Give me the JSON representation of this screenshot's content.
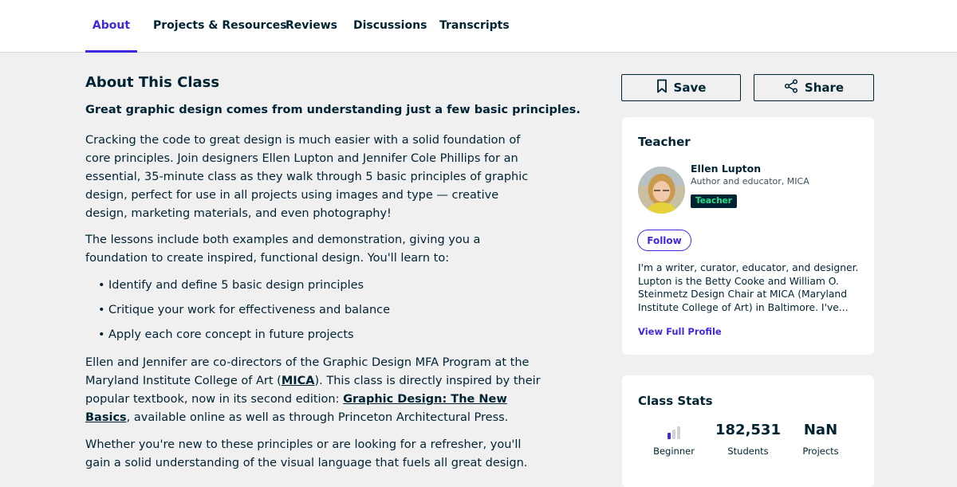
{
  "tabs": [
    {
      "label": "About",
      "active": true
    },
    {
      "label": "Projects & Resources"
    },
    {
      "label": "Reviews"
    },
    {
      "label": "Discussions"
    },
    {
      "label": "Transcripts"
    }
  ],
  "about": {
    "heading": "About This Class",
    "lead": "Great graphic design comes from understanding just a few basic principles.",
    "p1": "Cracking the code to great design is much easier with a solid foundation of core principles. Join designers Ellen Lupton and Jennifer Cole Phillips for an essential, 35-minute class as they walk through 5 basic principles of graphic design, perfect for use in all projects using images and type — creative design, marketing materials, and even photography!",
    "p2": "The lessons include both examples and demonstration, giving you a foundation to create inspired, functional design. You'll learn to:",
    "bullets": [
      "Identify and define 5 basic design principles",
      "Critique your work for effectiveness and balance",
      "Apply each core concept in future projects"
    ],
    "p3_a": "Ellen and Jennifer are co-directors of the Graphic Design MFA Program at the Maryland Institute College of Art (",
    "p3_link1": "MICA",
    "p3_b": "). This class is directly inspired by their popular textbook, now in its second edition: ",
    "p3_link2": "Graphic Design: The New Basics",
    "p3_c": ", available online as well as through Princeton Architectural Press.",
    "p4": "Whether you're new to these principles or are looking for a refresher, you'll gain a solid understanding of the visual language that fuels all great design."
  },
  "actions": {
    "save_label": "Save",
    "share_label": "Share",
    "save_icon": "bookmark-icon",
    "share_icon": "share-icon"
  },
  "teacher": {
    "title": "Teacher",
    "name": "Ellen Lupton",
    "role": "Author and educator, MICA",
    "badge": "Teacher",
    "follow_label": "Follow",
    "bio": "I'm a writer, curator, educator, and designer. Lupton is the Betty Cooke and William O. Steinmetz Design Chair at MICA (Maryland Institute College of Art) in Baltimore. I've...",
    "view_profile": "View Full Profile"
  },
  "stats": {
    "title": "Class Stats",
    "level": {
      "label": "Beginner",
      "level": 1,
      "max": 3
    },
    "students": {
      "value": "182,531",
      "label": "Students"
    },
    "projects": {
      "value": "NaN",
      "label": "Projects"
    }
  },
  "colors": {
    "accent": "#3d2ae0",
    "text": "#002333",
    "badge_text": "#26e08a",
    "page_bg": "#f0f0f0"
  }
}
